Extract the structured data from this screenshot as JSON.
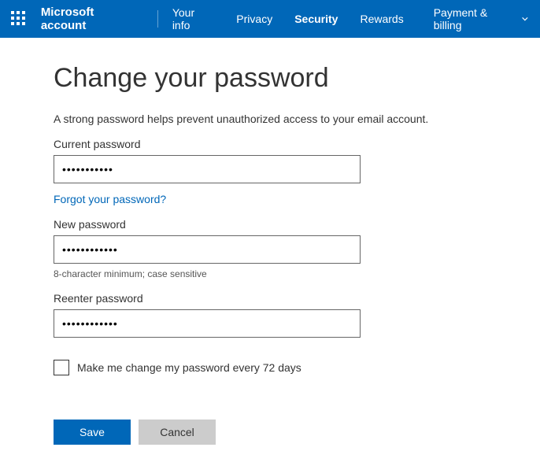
{
  "header": {
    "brand": "Microsoft account",
    "nav": {
      "your_info": "Your info",
      "privacy": "Privacy",
      "security": "Security",
      "rewards": "Rewards",
      "payment": "Payment & billing"
    }
  },
  "page": {
    "title": "Change your password",
    "subtitle": "A strong password helps prevent unauthorized access to your email account."
  },
  "form": {
    "current": {
      "label": "Current password",
      "value": "•••••••••••"
    },
    "forgot_link": "Forgot your password?",
    "new": {
      "label": "New password",
      "value": "••••••••••••"
    },
    "hint": "8-character minimum; case sensitive",
    "reenter": {
      "label": "Reenter password",
      "value": "••••••••••••"
    },
    "checkbox_label": "Make me change my password every 72 days",
    "save": "Save",
    "cancel": "Cancel"
  }
}
